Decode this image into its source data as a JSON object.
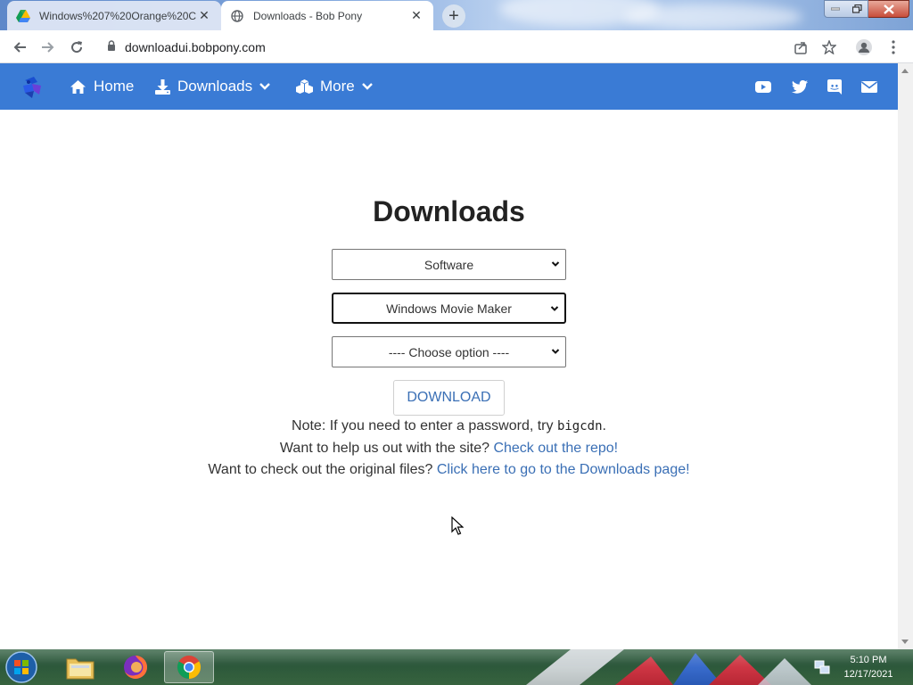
{
  "browser": {
    "tabs": [
      {
        "label": "Windows%207%20Orange%20C",
        "icon": "google-drive-icon",
        "active": false
      },
      {
        "label": "Downloads - Bob Pony",
        "icon": "globe-icon",
        "active": true
      }
    ],
    "url": "downloadui.bobpony.com"
  },
  "navbar": {
    "brand_icon": "bob-pony-logo",
    "items": [
      {
        "label": "Home",
        "icon": "home-icon"
      },
      {
        "label": "Downloads",
        "icon": "download-icon",
        "dropdown": true
      },
      {
        "label": "More",
        "icon": "cubes-icon",
        "dropdown": true
      }
    ],
    "social": [
      "youtube-icon",
      "twitter-icon",
      "discord-icon",
      "mail-icon"
    ],
    "color": "#3a7bd5"
  },
  "main": {
    "title": "Downloads",
    "selects": [
      {
        "value": "Software"
      },
      {
        "value": "Windows Movie Maker"
      },
      {
        "value": "---- Choose option ----"
      }
    ],
    "download_button": "DOWNLOAD",
    "note_prefix": "Note: If you need to enter a password, try ",
    "note_code": "bigcdn",
    "note_suffix": ".",
    "help_text": "Want to help us out with the site? ",
    "help_link": "Check out the repo!",
    "files_text": "Want to check out the original files? ",
    "files_link": "Click here to go to the Downloads page!",
    "link_color": "#3a6fb5"
  },
  "taskbar": {
    "time": "5:10 PM",
    "date": "12/17/2021",
    "apps": [
      "windows-start-icon",
      "file-explorer-icon",
      "firefox-icon",
      "chrome-icon"
    ]
  }
}
